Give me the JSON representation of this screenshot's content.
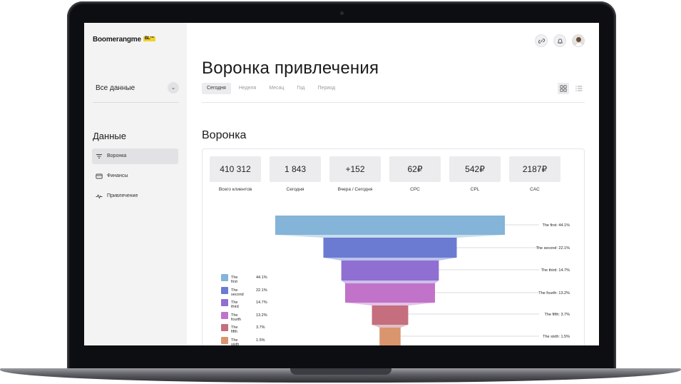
{
  "app": {
    "logo": "Boomerangme",
    "logo_badge": "BL™"
  },
  "sidebar": {
    "data_selector": "Все данные",
    "heading": "Данные",
    "items": [
      {
        "label": "Воронка",
        "active": true,
        "icon": "filter-icon"
      },
      {
        "label": "Финансы",
        "active": false,
        "icon": "card-icon"
      },
      {
        "label": "Привлечение",
        "active": false,
        "icon": "pulse-icon"
      }
    ]
  },
  "header": {
    "icons": [
      "link-icon",
      "bell-icon",
      "avatar"
    ],
    "title": "Воронка привлечения",
    "tabs": [
      {
        "label": "Сегодня",
        "active": true
      },
      {
        "label": "Неделя",
        "active": false
      },
      {
        "label": "Месяц",
        "active": false
      },
      {
        "label": "Год",
        "active": false
      },
      {
        "label": "Период",
        "active": false
      }
    ]
  },
  "section": {
    "title": "Воронка"
  },
  "stats": [
    {
      "value": "410 312",
      "label": "Всего клиентов"
    },
    {
      "value": "1 843",
      "label": "Сегодня"
    },
    {
      "value": "+152",
      "label": "Вчера / Сегодня"
    },
    {
      "value": "62₽",
      "label": "CPC"
    },
    {
      "value": "542₽",
      "label": "CPL"
    },
    {
      "value": "2187₽",
      "label": "CAC"
    }
  ],
  "chart_data": {
    "type": "funnel",
    "categories": [
      "The first",
      "The second",
      "The third",
      "The fourth",
      "The fifth",
      "The sixth"
    ],
    "values": [
      44.1,
      22.1,
      14.7,
      13.2,
      3.7,
      1.5
    ],
    "value_labels": [
      "44.1%",
      "22.1%",
      "14.7%",
      "13.2%",
      "3.7%",
      "1.5%"
    ],
    "callouts": [
      "The first: 44.1%",
      "The second: 22.1%",
      "The third: 14.7%",
      "The fourth: 13.2%",
      "The fifth: 3.7%",
      "The sixth: 1.5%"
    ],
    "colors": [
      "#84b4d8",
      "#6a7bd1",
      "#8f6fd2",
      "#c173c9",
      "#c46e7e",
      "#d9956e"
    ],
    "legend_position": "left"
  }
}
